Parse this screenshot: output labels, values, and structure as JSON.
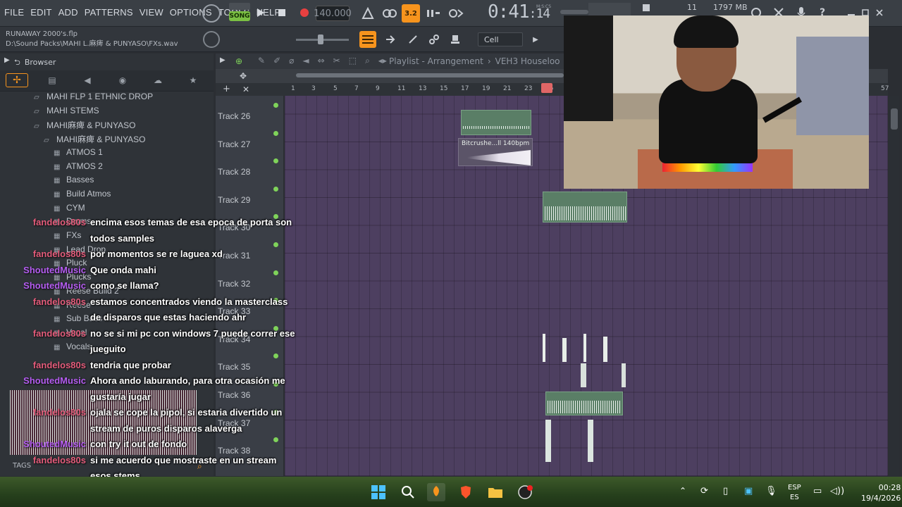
{
  "menu": [
    "FILE",
    "EDIT",
    "ADD",
    "PATTERNS",
    "VIEW",
    "OPTIONS",
    "TOOLS",
    "HELP"
  ],
  "transport": {
    "mode": "SONG",
    "tempo": "140.000",
    "time": "0:41",
    "time_frac": "14",
    "time_label": "M:S:CS",
    "pattern_num": "3.2"
  },
  "stats": {
    "cpu": "11",
    "mem": "1797 MB"
  },
  "project": {
    "name": "RUNAWAY 2000's.flp",
    "path": "D:\\Sound Packs\\MAHI L.麻痺 & PUNYASO\\FXs.wav"
  },
  "snap": "Cell",
  "browser": {
    "title": "Browser",
    "tags_label": "TAGS",
    "items": [
      {
        "label": "MAHI FLP 1 ETHNIC DROP",
        "icon": "folder-open-icon"
      },
      {
        "label": "MAHI STEMS",
        "icon": "folder-open-icon"
      },
      {
        "label": "MAHI麻痺 & PUNYASO",
        "icon": "folder-open-icon"
      },
      {
        "label": "MAHI麻痺 & PUNYASO",
        "icon": "folder-open-icon"
      },
      {
        "label": "ATMOS 1",
        "icon": "folder-icon"
      },
      {
        "label": "ATMOS 2",
        "icon": "folder-icon"
      },
      {
        "label": "Basses",
        "icon": "folder-icon"
      },
      {
        "label": "Build Atmos",
        "icon": "folder-icon"
      },
      {
        "label": "CYM",
        "icon": "folder-icon"
      },
      {
        "label": "Drums",
        "icon": "folder-icon"
      },
      {
        "label": "FXs",
        "icon": "folder-icon"
      },
      {
        "label": "Lead Drop",
        "icon": "folder-icon"
      },
      {
        "label": "Pluck",
        "icon": "folder-icon"
      },
      {
        "label": "Plucks",
        "icon": "folder-icon"
      },
      {
        "label": "Reese Build 2",
        "icon": "folder-icon"
      },
      {
        "label": "Reese",
        "icon": "folder-icon"
      },
      {
        "label": "Sub Bass",
        "icon": "folder-icon"
      },
      {
        "label": "Vocal",
        "icon": "folder-icon"
      },
      {
        "label": "Vocals",
        "icon": "folder-icon"
      }
    ]
  },
  "playlist": {
    "title": "Playlist - Arrangement",
    "pattern": "VEH3 Houseloo",
    "ruler": [
      "1",
      "3",
      "5",
      "7",
      "9",
      "11",
      "13",
      "15",
      "17",
      "19",
      "21",
      "23",
      "25",
      "57"
    ],
    "tracks": [
      "Track 26",
      "Track 27",
      "Track 28",
      "Track 29",
      "Track 30",
      "Track 31",
      "Track 32",
      "Track 33",
      "Track 34",
      "Track 35",
      "Track 36",
      "Track 37",
      "Track 38"
    ],
    "clip_label": "Bitcrushe...ll 140bpm"
  },
  "chat": [
    {
      "user": "fandelos80s",
      "user_color": "#e35b7a",
      "lines": [
        "encima esos temas de esa epoca de porta son",
        "todos samples"
      ]
    },
    {
      "user": "fandelos80s",
      "user_color": "#e35b7a",
      "lines": [
        "por momentos se re laguea xd"
      ]
    },
    {
      "user": "ShoutedMusic",
      "user_color": "#b45cf0",
      "lines": [
        "Que onda mahi"
      ]
    },
    {
      "user": "ShoutedMusic",
      "user_color": "#b45cf0",
      "lines": [
        "como se llama?"
      ]
    },
    {
      "user": "fandelos80s",
      "user_color": "#e35b7a",
      "lines": [
        "estamos concentrados viendo la masterclass",
        "de disparos que estas haciendo ahr"
      ]
    },
    {
      "user": "fandelos80s",
      "user_color": "#e35b7a",
      "lines": [
        "no se si mi pc con windows 7 puede correr ese",
        "jueguito"
      ]
    },
    {
      "user": "fandelos80s",
      "user_color": "#e35b7a",
      "lines": [
        "tendria que probar"
      ]
    },
    {
      "user": "ShoutedMusic",
      "user_color": "#b45cf0",
      "lines": [
        "Ahora ando laburando, para otra ocasión me",
        "gustaría jugar"
      ]
    },
    {
      "user": "fandelos80s",
      "user_color": "#e35b7a",
      "lines": [
        "ojala se cope la pipol, si estaria divertido un",
        "stream de puros disparos alaverga"
      ]
    },
    {
      "user": "ShoutedMusic",
      "user_color": "#b45cf0",
      "lines": [
        "con try it out de fondo"
      ]
    },
    {
      "user": "fandelos80s",
      "user_color": "#e35b7a",
      "lines": [
        "si me acuerdo que mostraste en un stream",
        "esos stems"
      ]
    }
  ],
  "taskbar": {
    "lang_top": "ESP",
    "lang_bottom": "ES",
    "time": "00:28",
    "date": "19/4/2026"
  },
  "colors": {
    "accent": "#f7941d",
    "grid": "#4d3f60",
    "clip": "#5a7e66",
    "song": "#7bc043"
  }
}
